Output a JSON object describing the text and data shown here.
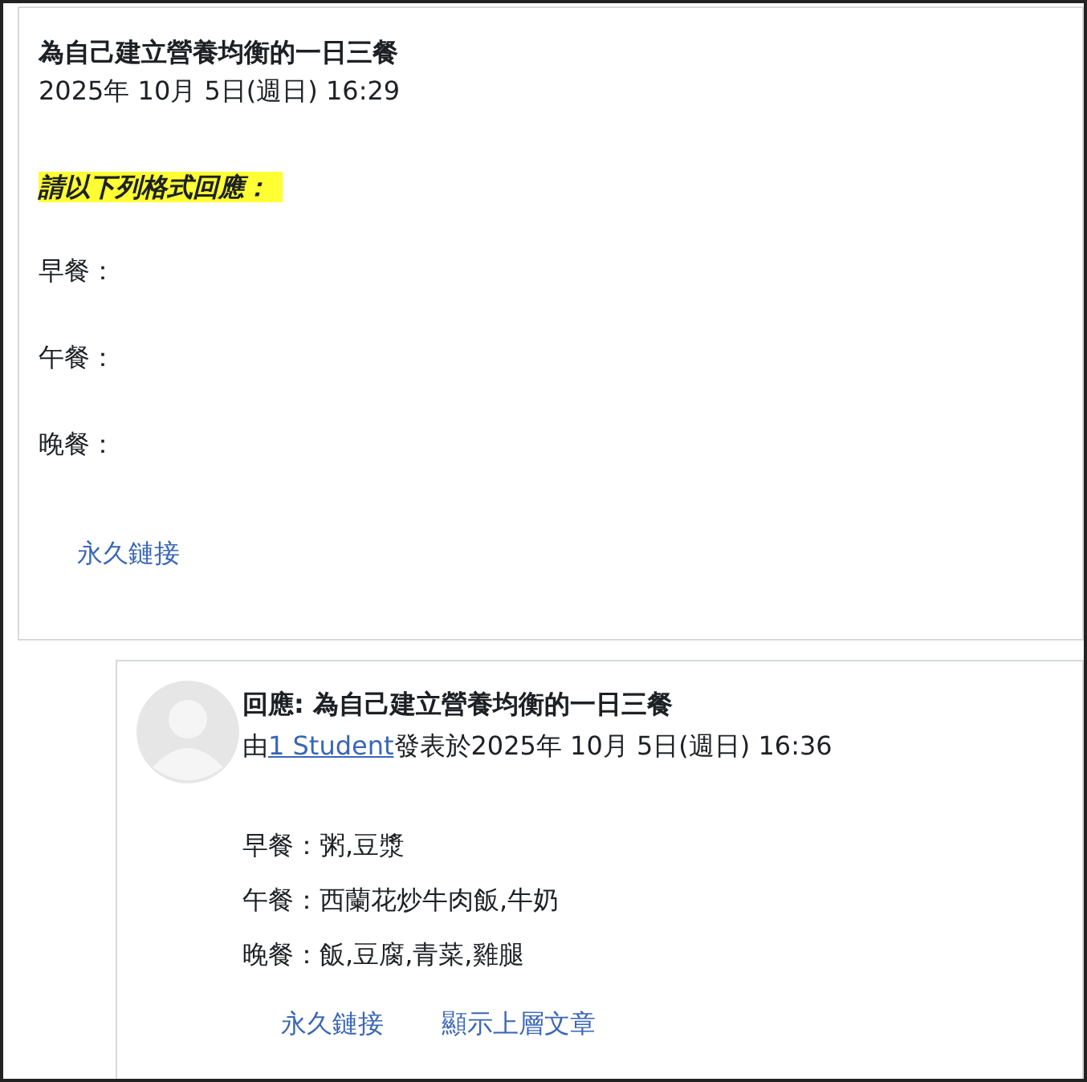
{
  "post": {
    "title": "為自己建立營養均衡的一日三餐",
    "date": "2025年 10月 5日(週日) 16:29",
    "prompt": "請以下列格式回應：",
    "lines": [
      "早餐：",
      "午餐：",
      "晚餐："
    ],
    "links": [
      "永久鏈接"
    ]
  },
  "reply": {
    "title": "回應: 為自己建立營養均衡的一日三餐",
    "by_prefix": "由",
    "author": "1 Student",
    "by_suffix": "發表於2025年 10月 5日(週日) 16:36",
    "lines": [
      "早餐：粥,豆漿",
      "午餐：西蘭花炒牛肉飯,牛奶",
      "晚餐：飯,豆腐,青菜,雞腿"
    ],
    "links": [
      "永久鏈接",
      "顯示上層文章"
    ]
  }
}
